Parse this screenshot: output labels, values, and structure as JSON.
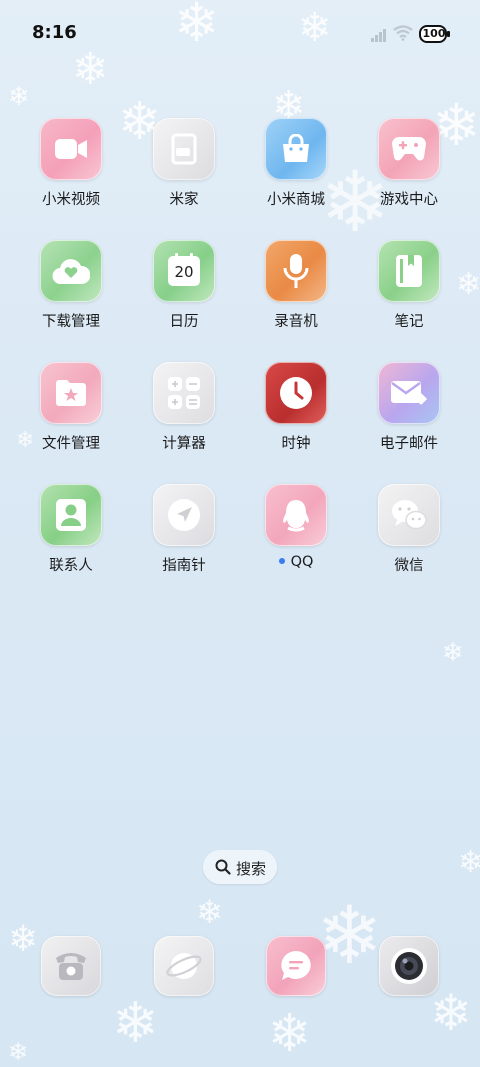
{
  "status_bar": {
    "time": "8:16",
    "battery": "100"
  },
  "apps": [
    {
      "label": "小米视频",
      "icon": "video-camera-icon"
    },
    {
      "label": "米家",
      "icon": "home-sofa-icon"
    },
    {
      "label": "小米商城",
      "icon": "shopping-bag-icon"
    },
    {
      "label": "游戏中心",
      "icon": "gamepad-icon"
    },
    {
      "label": "下载管理",
      "icon": "cloud-download-icon"
    },
    {
      "label": "日历",
      "icon": "calendar-icon",
      "calendar_day": "20"
    },
    {
      "label": "录音机",
      "icon": "microphone-icon"
    },
    {
      "label": "笔记",
      "icon": "notebook-icon"
    },
    {
      "label": "文件管理",
      "icon": "folder-star-icon"
    },
    {
      "label": "计算器",
      "icon": "calculator-icon"
    },
    {
      "label": "时钟",
      "icon": "clock-icon"
    },
    {
      "label": "电子邮件",
      "icon": "mail-icon"
    },
    {
      "label": "联系人",
      "icon": "contact-icon"
    },
    {
      "label": "指南针",
      "icon": "compass-icon"
    },
    {
      "label": "QQ",
      "icon": "qq-penguin-icon",
      "new_indicator": true
    },
    {
      "label": "微信",
      "icon": "wechat-icon"
    }
  ],
  "search": {
    "label": "搜索"
  },
  "dock": [
    {
      "icon": "phone-icon"
    },
    {
      "icon": "browser-planet-icon"
    },
    {
      "icon": "messages-icon"
    },
    {
      "icon": "camera-icon"
    }
  ]
}
